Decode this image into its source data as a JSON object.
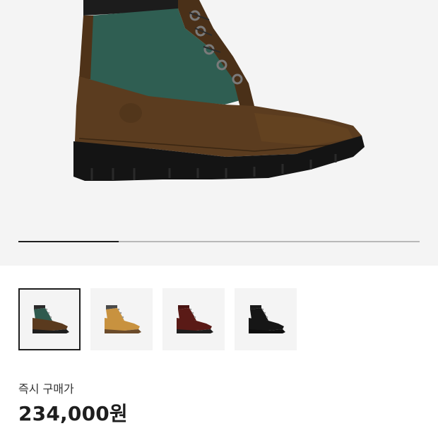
{
  "hero": {
    "image_name": "boot-image-brown-green",
    "progress": 0.25
  },
  "thumbnails": [
    {
      "name": "thumbnail-brown-green",
      "upper": "#5a3a1e",
      "panel": "#2f5a4e",
      "collar": "#2a2a2a",
      "sole": "#1e1e1e",
      "selected": true
    },
    {
      "name": "thumbnail-wheat",
      "upper": "#c8923f",
      "panel": "#c8923f",
      "collar": "#4a4a4a",
      "sole": "#6b4b2a",
      "selected": false
    },
    {
      "name": "thumbnail-burgundy",
      "upper": "#5a1a16",
      "panel": "#5a1a16",
      "collar": "#4a1412",
      "sole": "#1e1e1e",
      "selected": false
    },
    {
      "name": "thumbnail-black",
      "upper": "#161616",
      "panel": "#161616",
      "collar": "#1a1a1a",
      "sole": "#0e0e0e",
      "selected": false
    }
  ],
  "price": {
    "label": "즉시 구매가",
    "value": "234,000원"
  }
}
